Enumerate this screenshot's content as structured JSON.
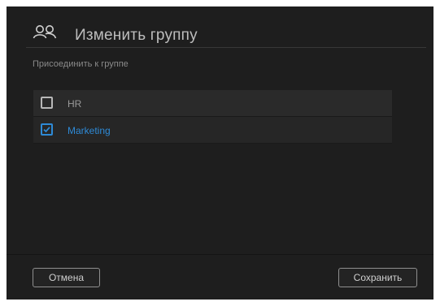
{
  "dialog": {
    "title": "Изменить группу",
    "icon": "users-icon",
    "section_label": "Присоединить к группе"
  },
  "groups": [
    {
      "label": "HR",
      "checked": false
    },
    {
      "label": "Marketing",
      "checked": true
    }
  ],
  "footer": {
    "cancel_label": "Отмена",
    "save_label": "Сохранить"
  },
  "colors": {
    "background": "#1e1e1e",
    "accent": "#2e8ad6",
    "text_muted": "#9a9a9a"
  }
}
